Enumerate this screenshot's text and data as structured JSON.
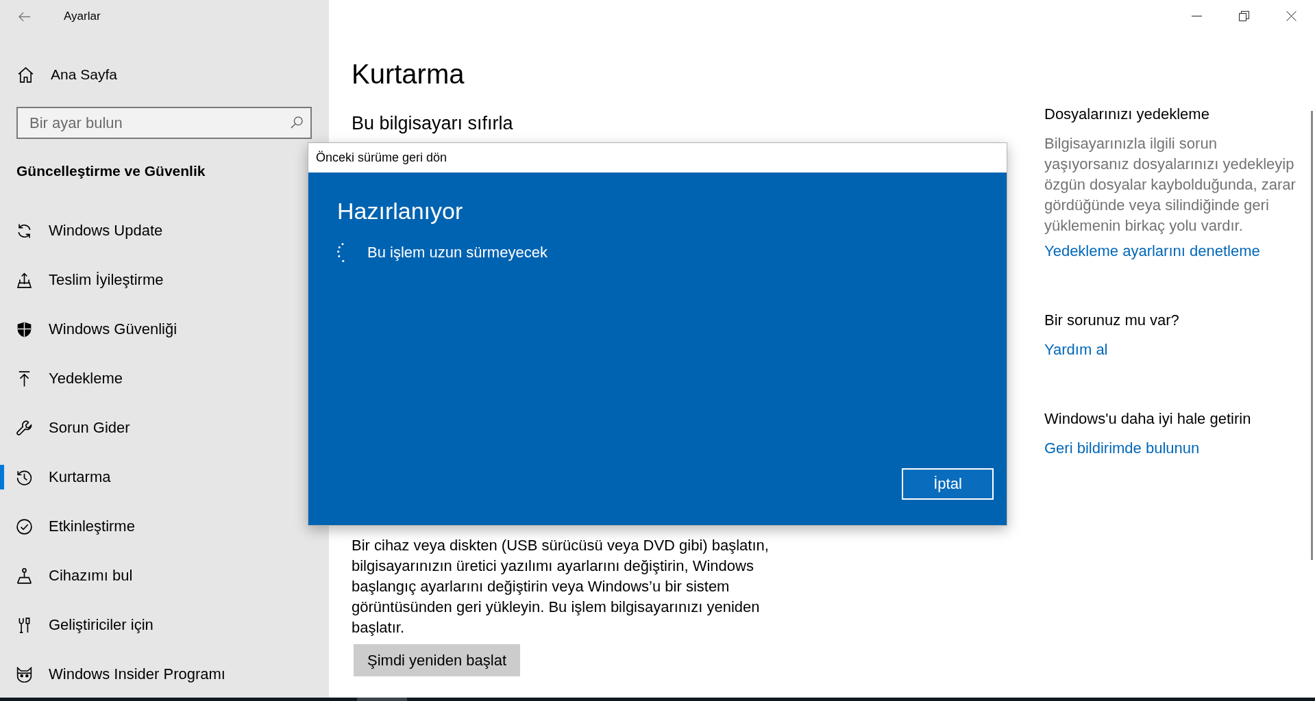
{
  "window": {
    "title": "Ayarlar"
  },
  "sidebar": {
    "home": "Ana Sayfa",
    "search": {
      "placeholder": "Bir ayar bulun"
    },
    "section": "Güncelleştirme ve Güvenlik",
    "items": [
      {
        "label": "Windows Update",
        "selected": false
      },
      {
        "label": "Teslim İyileştirme",
        "selected": false
      },
      {
        "label": "Windows Güvenliği",
        "selected": false
      },
      {
        "label": "Yedekleme",
        "selected": false
      },
      {
        "label": "Sorun Gider",
        "selected": false
      },
      {
        "label": "Kurtarma",
        "selected": true
      },
      {
        "label": "Etkinleştirme",
        "selected": false
      },
      {
        "label": "Cihazımı bul",
        "selected": false
      },
      {
        "label": "Geliştiriciler için",
        "selected": false
      },
      {
        "label": "Windows Insider Programı",
        "selected": false
      }
    ]
  },
  "main": {
    "title": "Kurtarma",
    "section_title": "Bu bilgisayarı sıfırla",
    "advanced_startup": {
      "description": "Bir cihaz veya diskten (USB sürücüsü veya DVD gibi) başlatın, bilgisayarınızın üretici yazılımı ayarlarını değiştirin, Windows başlangıç ayarlarını değiştirin veya Windows’u bir sistem görüntüsünden geri yükleyin. Bu işlem bilgisayarınızı yeniden başlatır.",
      "button": "Şimdi yeniden başlat"
    }
  },
  "related": [
    {
      "title": "Dosyalarınızı yedekleme",
      "description": "Bilgisayarınızla ilgili sorun yaşıyorsanız dosyalarınızı yedekleyip özgün dosyalar kaybolduğunda, zarar gördüğünde veya silindiğinde geri yüklemenin birkaç yolu vardır.",
      "link": "Yedekleme ayarlarını denetleme"
    },
    {
      "title": "Bir sorunuz mu var?",
      "link": "Yardım al"
    },
    {
      "title": "Windows'u daha iyi hale getirin",
      "link": "Geri bildirimde bulunun"
    }
  ],
  "dialog": {
    "title": "Önceki sürüme geri dön",
    "heading": "Hazırlanıyor",
    "message": "Bu işlem uzun sürmeyecek",
    "cancel_button": "İptal"
  }
}
